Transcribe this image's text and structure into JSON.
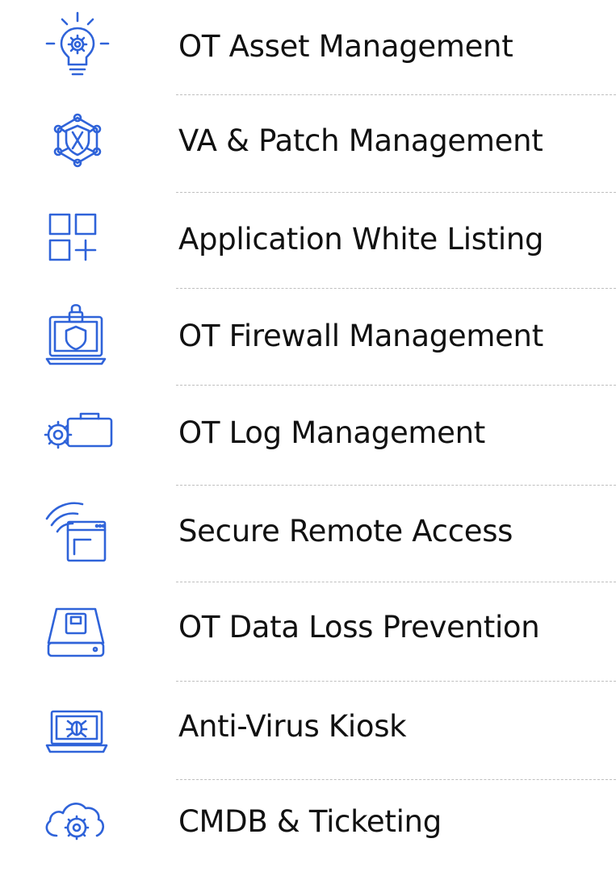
{
  "accent_color": "#2f63d9",
  "divider_color": "#bfbfbf",
  "items": [
    {
      "label": "OT Asset Management",
      "icon": "lightbulb-gear-icon"
    },
    {
      "label": "VA & Patch Management",
      "icon": "network-shield-icon"
    },
    {
      "label": "Application White Listing",
      "icon": "app-grid-plus-icon"
    },
    {
      "label": "OT Firewall Management",
      "icon": "laptop-shield-lock-icon"
    },
    {
      "label": "OT Log Management",
      "icon": "gear-briefcase-icon"
    },
    {
      "label": "Secure Remote Access",
      "icon": "wifi-window-icon"
    },
    {
      "label": "OT Data Loss Prevention",
      "icon": "hard-drive-icon"
    },
    {
      "label": "Anti-Virus Kiosk",
      "icon": "laptop-bug-icon"
    },
    {
      "label": "CMDB & Ticketing",
      "icon": "cloud-gear-icon"
    }
  ]
}
